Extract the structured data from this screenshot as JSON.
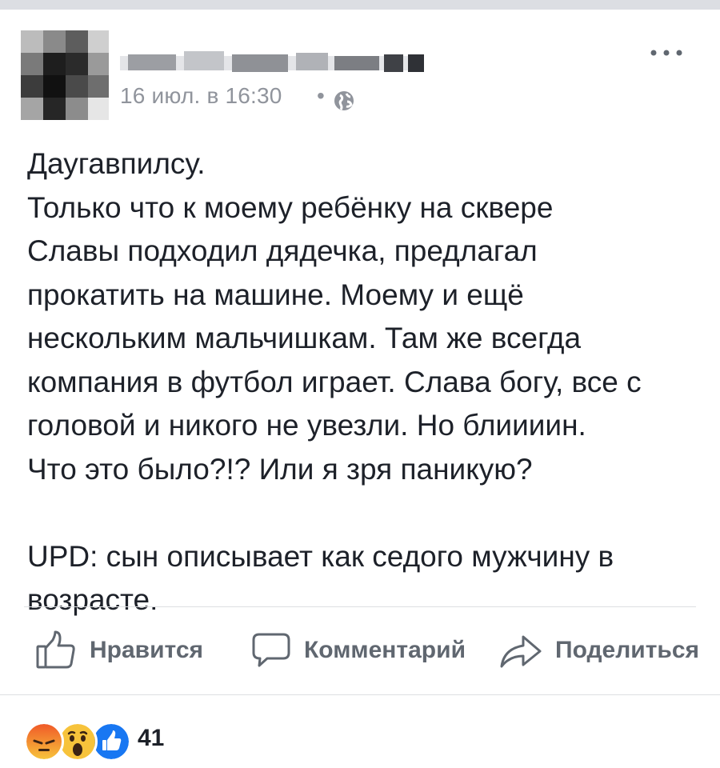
{
  "post": {
    "timestamp": "16 июл. в 16:30",
    "separator": "•",
    "privacy_icon": "globe-icon",
    "menu_icon": "more-dots-icon",
    "text_lines": [
      "Даугавпилсу.",
      "Только что к моему ребёнку на сквере",
      "Славы подходил дядечка, предлагал",
      "прокатить на машине. Моему и ещё",
      "нескольким мальчишкам. Там же всегда",
      "компания в футбол играет. Слава богу, все с",
      "головой и никого не увезли. Но блиииин.",
      "Что это было?!? Или я зря паникую?"
    ],
    "update_lines": [
      "UPD: сын описывает как седого мужчину в",
      "возрасте."
    ]
  },
  "actions": {
    "like_label": "Нравится",
    "comment_label": "Комментарий",
    "share_label": "Поделиться"
  },
  "reactions": {
    "types": [
      "angry",
      "wow",
      "like"
    ],
    "count": "41"
  },
  "colors": {
    "text": "#1d2129",
    "meta": "#90949c",
    "action": "#606770",
    "divider": "#dddfe2",
    "like_blue": "#1877f2",
    "angry_orange": "#f05a28",
    "wow_yellow": "#f7c33b"
  }
}
